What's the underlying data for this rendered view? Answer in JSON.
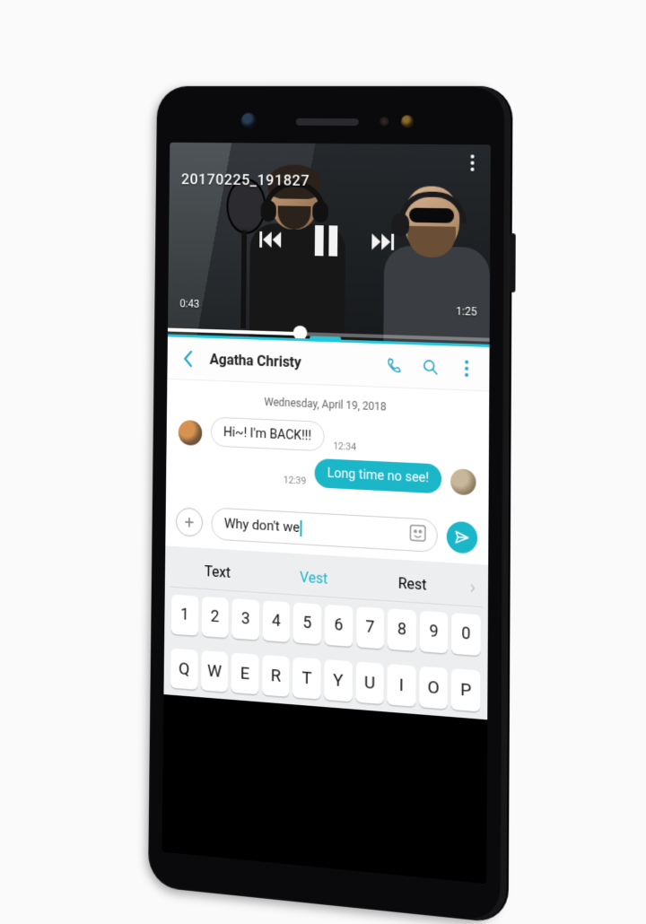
{
  "accent": "#1cb6c9",
  "player": {
    "title": "20170225_191827",
    "elapsed": "0:43",
    "total": "1:25",
    "progress_pct": 42
  },
  "chat": {
    "contact": "Agatha Christy",
    "date": "Wednesday, April 19, 2018",
    "messages": [
      {
        "dir": "in",
        "text": "Hi~! I'm BACK!!!",
        "time": "12:34"
      },
      {
        "dir": "out",
        "text": "Long time no see!",
        "time": "12:39"
      }
    ],
    "composer_text": "Why don't we"
  },
  "keyboard": {
    "suggestions": [
      "Text",
      "Vest",
      "Rest"
    ],
    "row_numbers": [
      "1",
      "2",
      "3",
      "4",
      "5",
      "6",
      "7",
      "8",
      "9",
      "0"
    ],
    "row_qwerty": [
      "Q",
      "W",
      "E",
      "R",
      "T",
      "Y",
      "U",
      "I",
      "O",
      "P"
    ]
  }
}
